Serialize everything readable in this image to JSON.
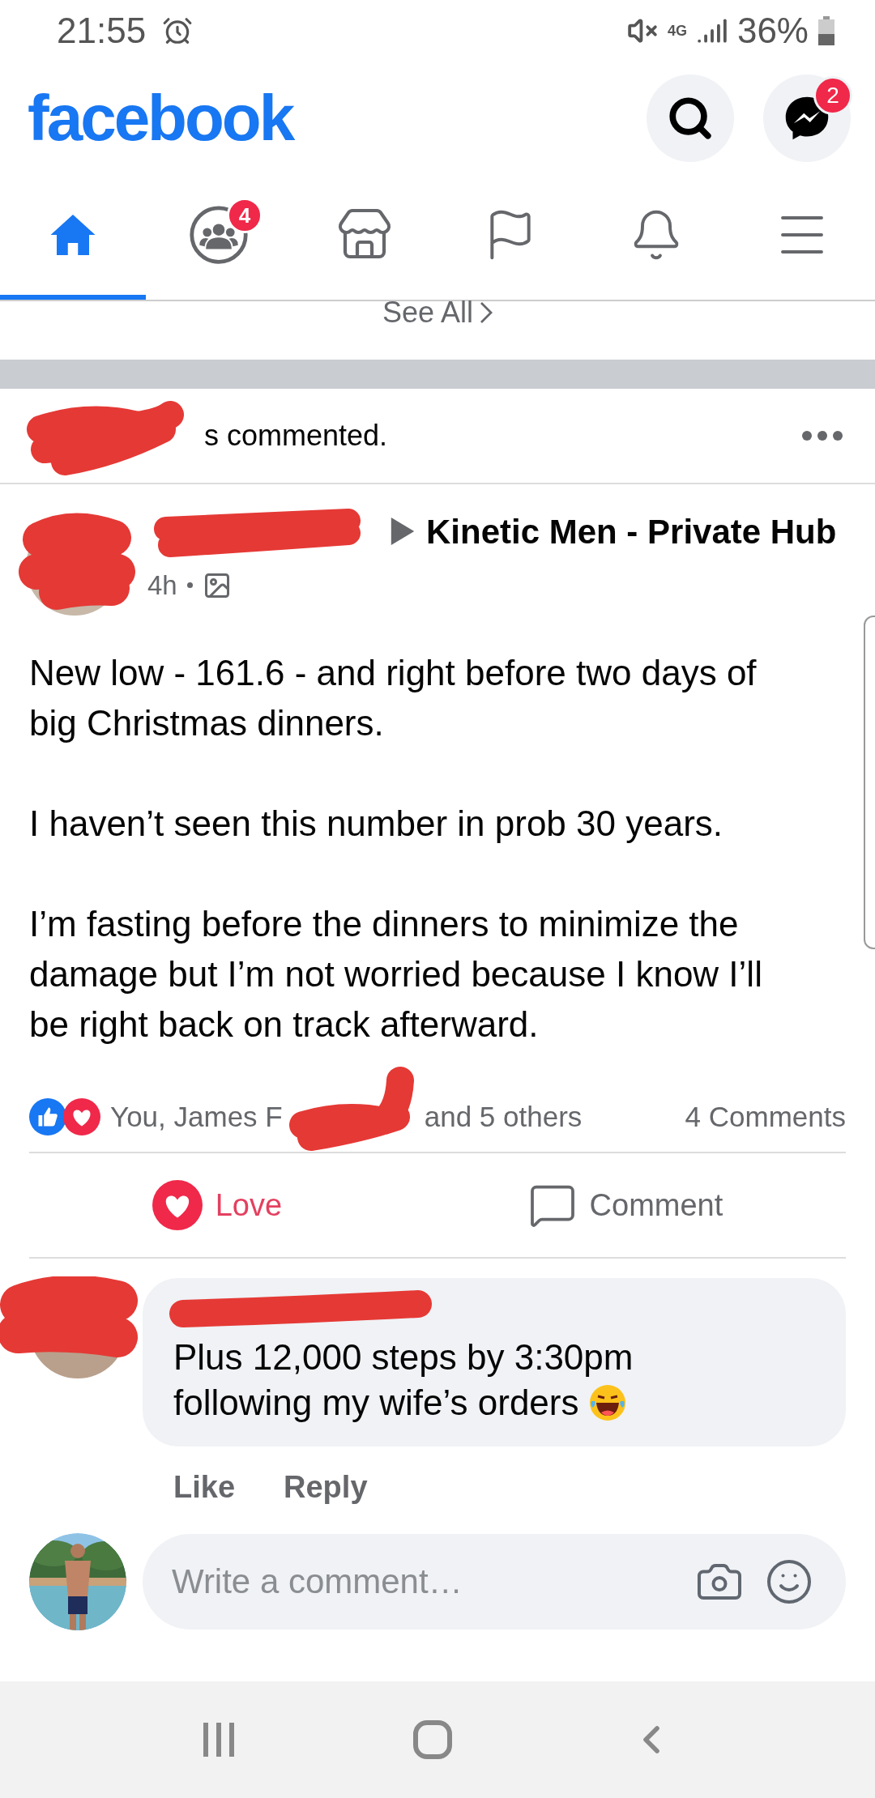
{
  "status_bar": {
    "time": "21:55",
    "network": "4G",
    "battery": "36%"
  },
  "header": {
    "logo": "facebook",
    "messenger_badge": "2"
  },
  "tabs": [
    {
      "kind": "home",
      "selected": true
    },
    {
      "kind": "groups",
      "selected": false,
      "badge": "4"
    },
    {
      "kind": "marketplace",
      "selected": false
    },
    {
      "kind": "pages",
      "selected": false
    },
    {
      "kind": "notifications",
      "selected": false
    },
    {
      "kind": "menu",
      "selected": false
    }
  ],
  "see_all": "See All",
  "notification": {
    "text": "s commented."
  },
  "post": {
    "group": "Kinetic Men - Private Hub",
    "time": "4h",
    "paragraphs": [
      "New low - 161.6 - and right before two days of big Christmas dinners.",
      "I haven’t seen this number in prob 30 years.",
      "I’m fasting before the dinners to minimize the damage but I’m not worried because I know I’ll be right back on track afterward."
    ],
    "reactions_before": "You, James F",
    "reactions_after": "and 5 others",
    "comments_count": "4 Comments",
    "actions": [
      {
        "kind": "love",
        "label": "Love",
        "selected": true
      },
      {
        "kind": "comment",
        "label": "Comment",
        "selected": false
      }
    ]
  },
  "comment": {
    "lines": [
      "Plus 12,000 steps by 3:30pm",
      "following my wife’s orders"
    ],
    "actions": [
      "Like",
      "Reply"
    ]
  },
  "composer": {
    "placeholder": "Write a comment…"
  }
}
